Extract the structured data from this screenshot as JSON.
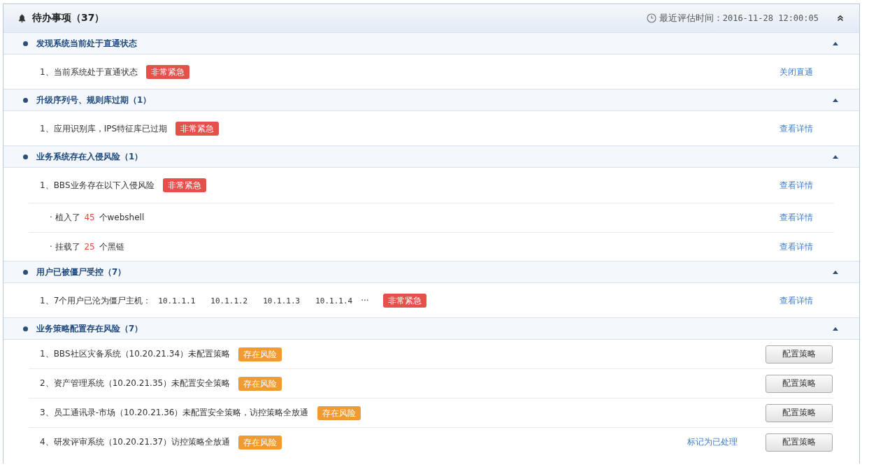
{
  "panel": {
    "title": "待办事项（37）",
    "eval_label": "最近评估时间：",
    "eval_time": "2016-11-28  12:00:05",
    "expanded": true
  },
  "sections": [
    {
      "title": "发现系统当前处于直通状态",
      "expanded": true,
      "items": [
        {
          "kind": "issue",
          "text": "1、当前系统处于直通状态",
          "badge": {
            "label": "非常紧急",
            "kind": "urgent"
          },
          "link": "关闭直通"
        }
      ]
    },
    {
      "title": "升级序列号、规则库过期（1）",
      "expanded": true,
      "items": [
        {
          "kind": "issue",
          "text": "1、应用识别库，IPS特征库已过期",
          "badge": {
            "label": "非常紧急",
            "kind": "urgent"
          },
          "link": "查看详情"
        }
      ]
    },
    {
      "title": "业务系统存在入侵风险（1）",
      "expanded": true,
      "items": [
        {
          "kind": "issue",
          "text": "1、BBS业务存在以下入侵风险",
          "badge": {
            "label": "非常紧急",
            "kind": "urgent"
          },
          "link": "查看详情"
        },
        {
          "kind": "sub",
          "prefix": "· 植入了",
          "count": "45",
          "suffix": "个webshell",
          "link": "查看详情"
        },
        {
          "kind": "sub",
          "prefix": "· 挂载了",
          "count": "25",
          "suffix": "个黑链",
          "link": "查看详情"
        }
      ]
    },
    {
      "title": "用户已被僵尸受控（7）",
      "expanded": true,
      "items": [
        {
          "kind": "hosts",
          "text": "1、7个用户已沦为僵尸主机：",
          "hosts": [
            "10.1.1.1",
            "10.1.1.2",
            "10.1.1.3",
            "10.1.1.4"
          ],
          "more": "···",
          "badge": {
            "label": "非常紧急",
            "kind": "urgent"
          },
          "link": "查看详情"
        }
      ]
    },
    {
      "title": "业务策略配置存在风险（7）",
      "expanded": true,
      "items": [
        {
          "kind": "policy",
          "text": "1、BBS社区灾备系统（10.20.21.34）未配置策略",
          "badge": {
            "label": "存在风险",
            "kind": "risk"
          },
          "button": "配置策略"
        },
        {
          "kind": "policy",
          "text": "2、资产管理系统（10.20.21.35）未配置安全策略",
          "badge": {
            "label": "存在风险",
            "kind": "risk"
          },
          "button": "配置策略"
        },
        {
          "kind": "policy",
          "text": "3、员工通讯录-市场（10.20.21.36）未配置安全策略，访控策略全放通",
          "badge": {
            "label": "存在风险",
            "kind": "risk"
          },
          "button": "配置策略"
        },
        {
          "kind": "policy",
          "text": "4、研发评审系统（10.20.21.37）访控策略全放通",
          "badge": {
            "label": "存在风险",
            "kind": "risk"
          },
          "link": "标记为已处理",
          "button": "配置策略"
        }
      ]
    }
  ]
}
